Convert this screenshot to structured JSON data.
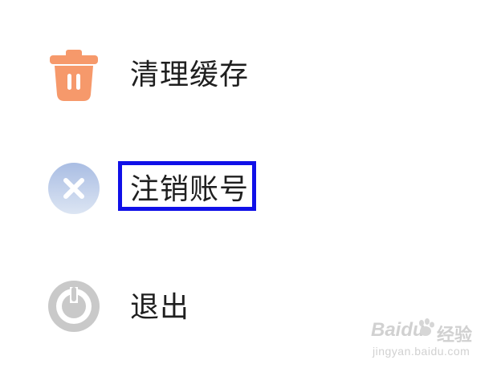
{
  "menu": {
    "items": [
      {
        "label": "清理缓存",
        "icon": "trash-icon",
        "color": "#F6996B"
      },
      {
        "label": "注销账号",
        "icon": "close-circle-icon",
        "color": "#B8C9E6"
      },
      {
        "label": "退出",
        "icon": "power-icon",
        "color": "#C9C9C9"
      }
    ]
  },
  "highlight": {
    "color": "#1010E8",
    "target": "注销账号"
  },
  "watermark": {
    "brand": "Baidu",
    "brand_cn": "经验",
    "url": "jingyan.baidu.com"
  }
}
